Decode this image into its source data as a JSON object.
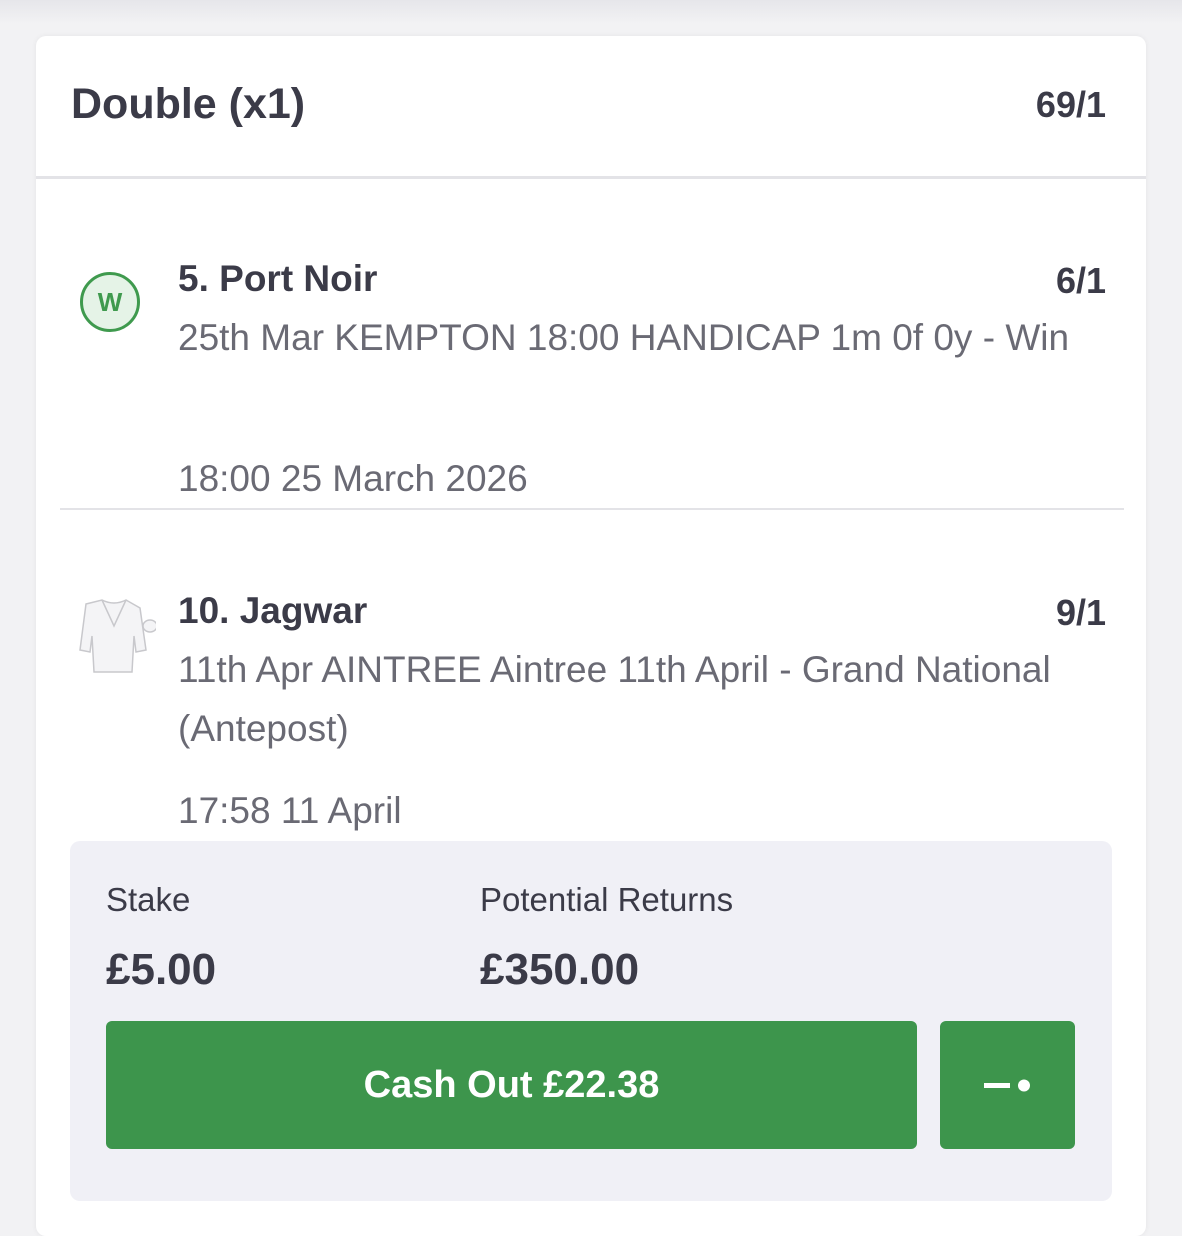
{
  "bet": {
    "type": "Double (x1)",
    "odds": "69/1"
  },
  "selections": [
    {
      "name": "5. Port Noir",
      "odds": "6/1",
      "description": "25th Mar KEMPTON 18:00 HANDICAP 1m 0f 0y - Win",
      "time": "18:00 25 March 2026",
      "badge": "W",
      "icon": "win-badge-icon"
    },
    {
      "name": "10. Jagwar",
      "odds": "9/1",
      "description": "11th Apr AINTREE Aintree 11th April - Grand National (Antepost)",
      "time": "17:58 11 April",
      "icon": "jockey-silks-icon"
    }
  ],
  "stake": {
    "label": "Stake",
    "value": "£5.00"
  },
  "returns": {
    "label": "Potential Returns",
    "value": "£350.00"
  },
  "cashout": {
    "label": "Cash Out £22.38",
    "slider_icon": "partial-cashout-slider-icon"
  },
  "colors": {
    "accent_green": "#3d954c",
    "text_dark": "#3b3b48",
    "text_muted": "#6a6a74",
    "panel_bg": "#f0f0f6"
  }
}
